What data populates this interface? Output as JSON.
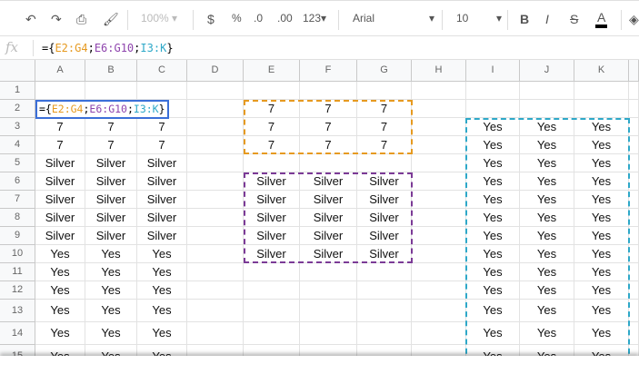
{
  "toolbar": {
    "zoom": "100%",
    "currency": "$",
    "percent": "%",
    "dec_less": ".0",
    "dec_more": ".00",
    "format": "123",
    "font": "Arial",
    "font_size": "10",
    "bold": "B",
    "italic": "I",
    "strike": "S",
    "text_color": "A"
  },
  "formula_bar": {
    "fx": "fx",
    "prefix": "={",
    "r1": "E2:G4",
    "s1": ";",
    "r2": "E6:G10",
    "s2": ";",
    "r3": "I3:K",
    "suffix": "}"
  },
  "columns": [
    "A",
    "B",
    "C",
    "D",
    "E",
    "F",
    "G",
    "H",
    "I",
    "J",
    "K"
  ],
  "rows": [
    [
      "",
      "",
      "",
      "",
      "",
      "",
      "",
      "",
      "",
      "",
      ""
    ],
    [
      "",
      "",
      "",
      "",
      "7",
      "7",
      "7",
      "",
      "",
      "",
      ""
    ],
    [
      "7",
      "7",
      "7",
      "",
      "7",
      "7",
      "7",
      "",
      "Yes",
      "Yes",
      "Yes"
    ],
    [
      "7",
      "7",
      "7",
      "",
      "7",
      "7",
      "7",
      "",
      "Yes",
      "Yes",
      "Yes"
    ],
    [
      "Silver",
      "Silver",
      "Silver",
      "",
      "",
      "",
      "",
      "",
      "Yes",
      "Yes",
      "Yes"
    ],
    [
      "Silver",
      "Silver",
      "Silver",
      "",
      "Silver",
      "Silver",
      "Silver",
      "",
      "Yes",
      "Yes",
      "Yes"
    ],
    [
      "Silver",
      "Silver",
      "Silver",
      "",
      "Silver",
      "Silver",
      "Silver",
      "",
      "Yes",
      "Yes",
      "Yes"
    ],
    [
      "Silver",
      "Silver",
      "Silver",
      "",
      "Silver",
      "Silver",
      "Silver",
      "",
      "Yes",
      "Yes",
      "Yes"
    ],
    [
      "Silver",
      "Silver",
      "Silver",
      "",
      "Silver",
      "Silver",
      "Silver",
      "",
      "Yes",
      "Yes",
      "Yes"
    ],
    [
      "Yes",
      "Yes",
      "Yes",
      "",
      "Silver",
      "Silver",
      "Silver",
      "",
      "Yes",
      "Yes",
      "Yes"
    ],
    [
      "Yes",
      "Yes",
      "Yes",
      "",
      "",
      "",
      "",
      "",
      "Yes",
      "Yes",
      "Yes"
    ],
    [
      "Yes",
      "Yes",
      "Yes",
      "",
      "",
      "",
      "",
      "",
      "Yes",
      "Yes",
      "Yes"
    ],
    [
      "Yes",
      "Yes",
      "Yes",
      "",
      "",
      "",
      "",
      "",
      "Yes",
      "Yes",
      "Yes"
    ],
    [
      "Yes",
      "Yes",
      "Yes",
      "",
      "",
      "",
      "",
      "",
      "Yes",
      "Yes",
      "Yes"
    ],
    [
      "Yes",
      "Yes",
      "Yes",
      "",
      "",
      "",
      "",
      "",
      "Yes",
      "Yes",
      "Yes"
    ]
  ],
  "colors": {
    "orange": "#e69a20",
    "purple": "#7b3a96",
    "teal": "#2ea8c8",
    "active": "#3b6fd8"
  }
}
